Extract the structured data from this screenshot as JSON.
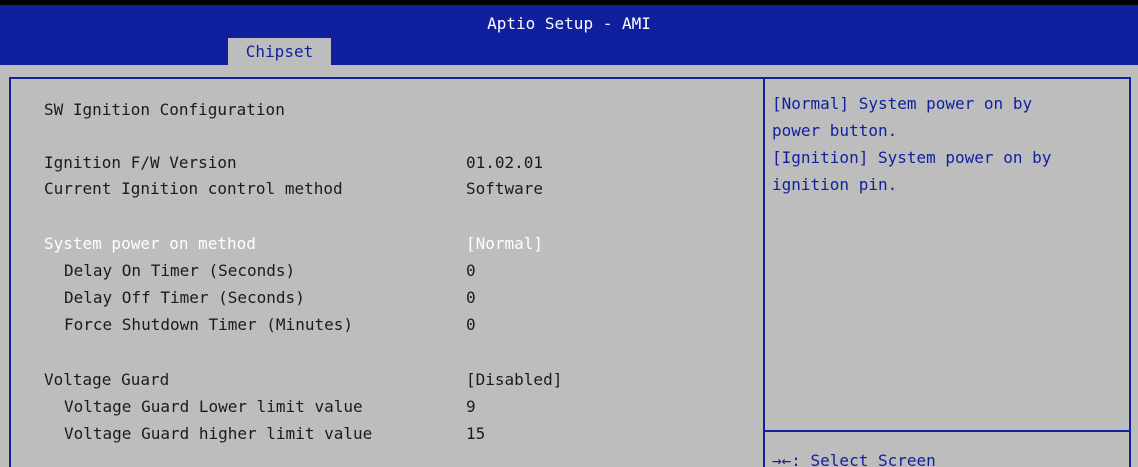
{
  "header": {
    "app_title": "Aptio Setup - AMI",
    "active_tab": "Chipset"
  },
  "main": {
    "section_title": "SW Ignition Configuration",
    "info": [
      {
        "label": "Ignition F/W Version",
        "value": "01.02.01"
      },
      {
        "label": "Current Ignition control method",
        "value": "Software"
      }
    ],
    "power": {
      "label": "System power on method",
      "value": "[Normal]",
      "items": [
        {
          "label": "Delay On Timer (Seconds)",
          "value": "0"
        },
        {
          "label": "Delay Off Timer (Seconds)",
          "value": "0"
        },
        {
          "label": "Force Shutdown Timer (Minutes)",
          "value": "0"
        }
      ]
    },
    "voltage": {
      "label": "Voltage Guard",
      "value": "[Disabled]",
      "items": [
        {
          "label": "Voltage Guard Lower limit value",
          "value": "9"
        },
        {
          "label": "Voltage Guard higher limit value",
          "value": "15"
        }
      ]
    }
  },
  "help": {
    "lines": [
      "[Normal] System power on by",
      "power button.",
      "[Ignition] System power on by",
      "ignition pin."
    ],
    "key_hint": "→←: Select Screen"
  },
  "colors": {
    "header_blue": "#0f1f9e",
    "panel_gray": "#bdbdbd",
    "text_dark": "#1b1b1b",
    "highlight_white": "#ffffff"
  }
}
